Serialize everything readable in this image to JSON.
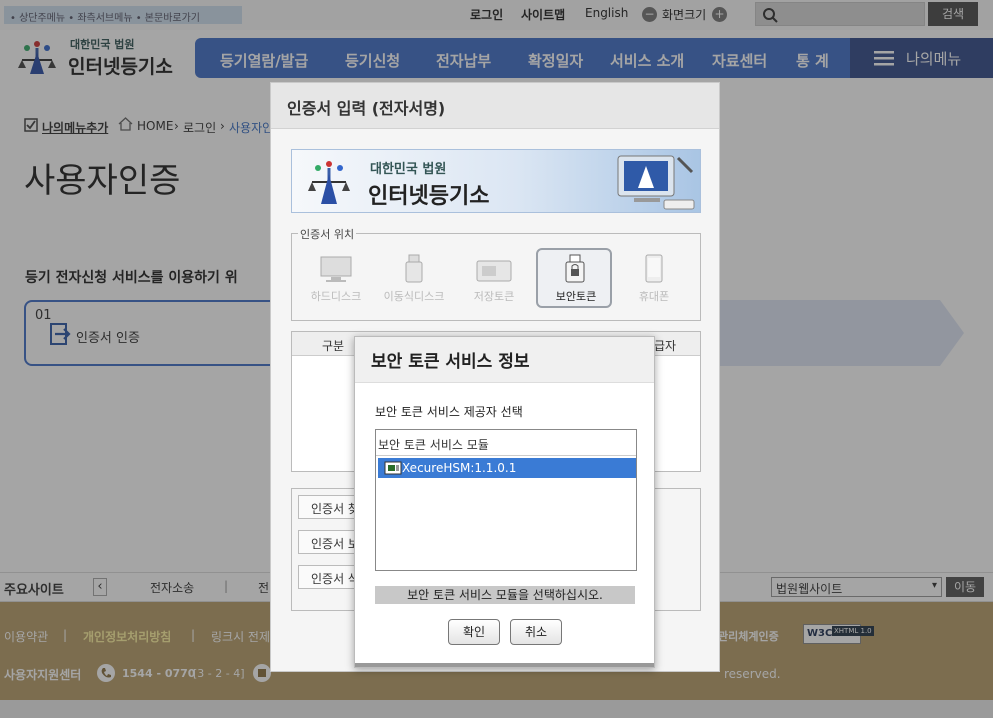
{
  "header": {
    "skip_links": "• 상단주메뉴  • 좌측서브메뉴  • 본문바로가기",
    "util": {
      "login": "로그인",
      "sitemap": "사이트맵",
      "english": "English",
      "screen_size": "화면크기"
    },
    "search_button": "검색",
    "logo": {
      "line1": "대한민국 법원",
      "line2": "인터넷등기소"
    }
  },
  "nav": {
    "items": [
      "등기열람/발급",
      "등기신청",
      "전자납부",
      "확정일자",
      "서비스 소개",
      "자료센터",
      "통 계"
    ],
    "my_menu": "나의메뉴"
  },
  "breadcrumb": {
    "add_menu": "나의메뉴추가",
    "home": "HOME",
    "login": "로그인",
    "current": "사용자인"
  },
  "page": {
    "title": "사용자인증",
    "service_text": "등기 전자신청 서비스를 이용하기 위",
    "step_number": "01",
    "step_label": "인증서 인증"
  },
  "sites": {
    "label": "주요사이트",
    "prev": "‹",
    "item1": "전자소송",
    "item2": "전",
    "select_value": "법원웹사이트",
    "go_button": "이동"
  },
  "footer": {
    "terms": "이용약관",
    "privacy": "개인정보처리방침",
    "link": "링크시 전제",
    "cert_mgmt": "관리체계인증",
    "w3c": "XHTML 1.0",
    "support_center": "사용자지원센터",
    "phone": "1544 - 0770",
    "phone_ext": "[3 - 2 - 4]",
    "copyright": "reserved."
  },
  "cert_dialog": {
    "title": "인증서 입력 (전자서명)",
    "banner_line1": "대한민국 법원",
    "banner_line2": "인터넷등기소",
    "location_legend": "인증서 위치",
    "locations": [
      "하드디스크",
      "이동식디스크",
      "저장토큰",
      "보안토큰",
      "휴대폰"
    ],
    "table_col1": "구분",
    "table_col_last": "급자",
    "side_buttons": [
      "인증서 찾",
      "인증서 보",
      "인증서 삭"
    ]
  },
  "modal": {
    "title": "보안 토큰 서비스 정보",
    "prompt": "보안 토큰 서비스 제공자 선택",
    "list_header": "보안 토큰 서비스 모듈",
    "items": [
      "XecureHSM:1.1.0.1"
    ],
    "status": "보안 토큰 서비스 모듈을 선택하십시오.",
    "ok_button": "확인",
    "cancel_button": "취소"
  }
}
